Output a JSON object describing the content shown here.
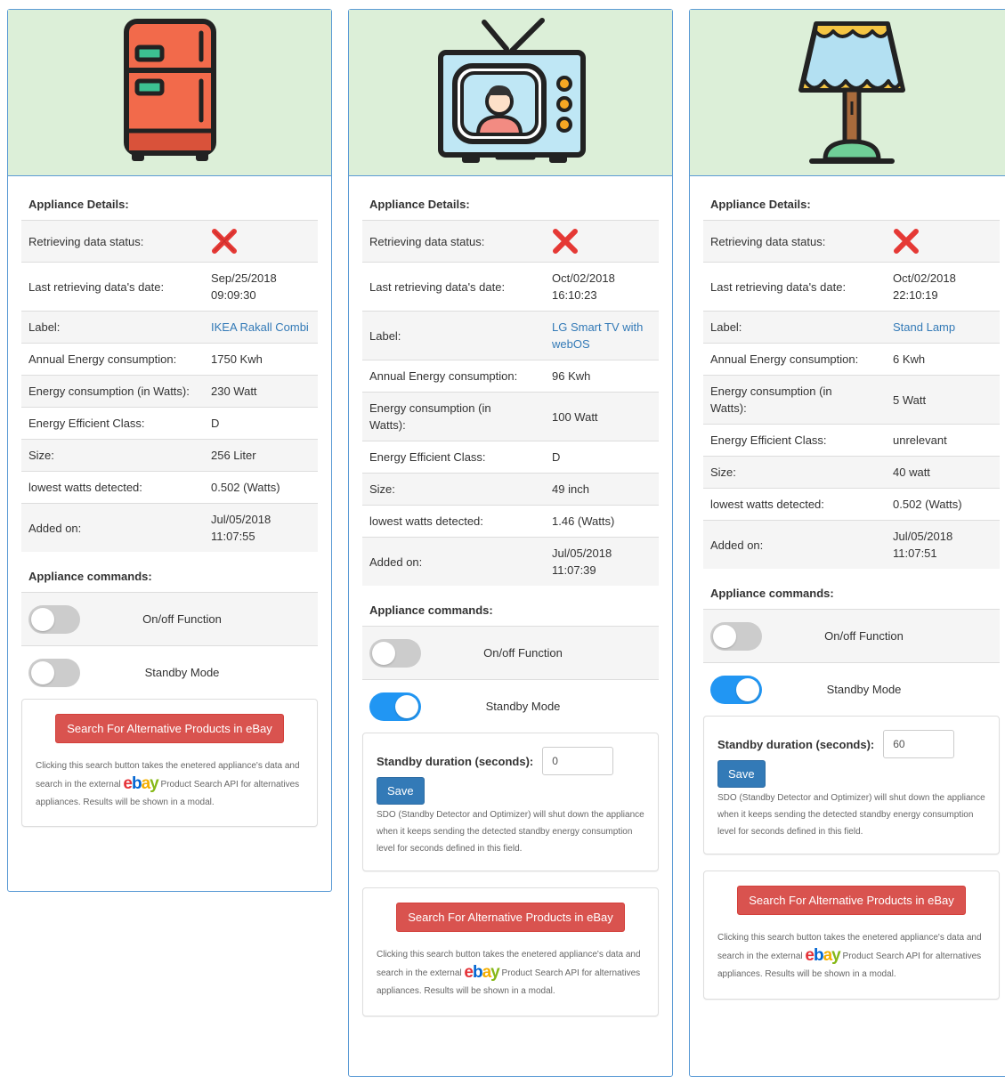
{
  "colors": {
    "card_image_bg": "#dcefd8",
    "card_border": "#5b9bd5",
    "toggle_on": "#2196f3",
    "toggle_off": "#cccccc",
    "ebay_button": "#d9534f",
    "save_button": "#337ab7",
    "link": "#337ab7",
    "status_fail": "#e53935"
  },
  "cards": [
    {
      "icon": "fridge-icon",
      "details_title": "Appliance Details:",
      "rows": [
        {
          "key": "Retrieving data status:",
          "value": "",
          "status_icon": "red-x-icon"
        },
        {
          "key": "Last retrieving data's date:",
          "value": "Sep/25/2018 09:09:30"
        },
        {
          "key": "Label:",
          "value": "IKEA Rakall Combi",
          "link": true
        },
        {
          "key": "Annual Energy consumption:",
          "value": "1750 Kwh"
        },
        {
          "key": "Energy consumption (in Watts):",
          "value": "230 Watt"
        },
        {
          "key": "Energy Efficient Class:",
          "value": "D"
        },
        {
          "key": "Size:",
          "value": "256 Liter"
        },
        {
          "key": "lowest watts detected:",
          "value": "0.502 (Watts)"
        },
        {
          "key": "Added on:",
          "value": "Jul/05/2018 11:07:55"
        }
      ],
      "commands_title": "Appliance commands:",
      "onoff_label": "On/off Function",
      "onoff_on": false,
      "standby_label": "Standby Mode",
      "standby_on": false,
      "show_standby": false,
      "standby_duration_label": "Standby duration (seconds):",
      "standby_duration_value": "",
      "save_label": "Save",
      "sdo_text": "",
      "ebay_button_label": "Search For Alternative Products in eBay",
      "ebay_text_before": "Clicking this search button takes the enetered appliance's data and search in the external",
      "ebay_text_after": "Product Search API for alternatives appliances. Results will be shown in a modal.",
      "ebay_logo": [
        "e",
        "b",
        "a",
        "y"
      ]
    },
    {
      "icon": "tv-icon",
      "details_title": "Appliance Details:",
      "rows": [
        {
          "key": "Retrieving data status:",
          "value": "",
          "status_icon": "red-x-icon"
        },
        {
          "key": "Last retrieving data's date:",
          "value": "Oct/02/2018 16:10:23"
        },
        {
          "key": "Label:",
          "value": "LG Smart TV with webOS",
          "link": true
        },
        {
          "key": "Annual Energy consumption:",
          "value": "96 Kwh"
        },
        {
          "key": "Energy consumption (in Watts):",
          "value": "100 Watt"
        },
        {
          "key": "Energy Efficient Class:",
          "value": "D"
        },
        {
          "key": "Size:",
          "value": "49 inch"
        },
        {
          "key": "lowest watts detected:",
          "value": "1.46 (Watts)"
        },
        {
          "key": "Added on:",
          "value": "Jul/05/2018 11:07:39"
        }
      ],
      "commands_title": "Appliance commands:",
      "onoff_label": "On/off Function",
      "onoff_on": false,
      "standby_label": "Standby Mode",
      "standby_on": true,
      "show_standby": true,
      "standby_duration_label": "Standby duration (seconds):",
      "standby_duration_value": "0",
      "save_label": "Save",
      "sdo_text": "SDO (Standby Detector and Optimizer) will shut down the appliance when it keeps sending the detected standby energy consumption level for seconds defined in this field.",
      "ebay_button_label": "Search For Alternative Products in eBay",
      "ebay_text_before": "Clicking this search button takes the enetered appliance's data and search in the external",
      "ebay_text_after": "Product Search API for alternatives appliances. Results will be shown in a modal.",
      "ebay_logo": [
        "e",
        "b",
        "a",
        "y"
      ]
    },
    {
      "icon": "lamp-icon",
      "details_title": "Appliance Details:",
      "rows": [
        {
          "key": "Retrieving data status:",
          "value": "",
          "status_icon": "red-x-icon"
        },
        {
          "key": "Last retrieving data's date:",
          "value": "Oct/02/2018 22:10:19"
        },
        {
          "key": "Label:",
          "value": "Stand Lamp",
          "link": true
        },
        {
          "key": "Annual Energy consumption:",
          "value": "6 Kwh"
        },
        {
          "key": "Energy consumption (in Watts):",
          "value": "5 Watt"
        },
        {
          "key": "Energy Efficient Class:",
          "value": "unrelevant"
        },
        {
          "key": "Size:",
          "value": "40 watt"
        },
        {
          "key": "lowest watts detected:",
          "value": "0.502 (Watts)"
        },
        {
          "key": "Added on:",
          "value": "Jul/05/2018 11:07:51"
        }
      ],
      "commands_title": "Appliance commands:",
      "onoff_label": "On/off Function",
      "onoff_on": false,
      "standby_label": "Standby Mode",
      "standby_on": true,
      "show_standby": true,
      "standby_duration_label": "Standby duration (seconds):",
      "standby_duration_value": "60",
      "save_label": "Save",
      "sdo_text": "SDO (Standby Detector and Optimizer) will shut down the appliance when it keeps sending the detected standby energy consumption level for seconds defined in this field.",
      "ebay_button_label": "Search For Alternative Products in eBay",
      "ebay_text_before": "Clicking this search button takes the enetered appliance's data and search in the external",
      "ebay_text_after": "Product Search API for alternatives appliances. Results will be shown in a modal.",
      "ebay_logo": [
        "e",
        "b",
        "a",
        "y"
      ]
    }
  ]
}
